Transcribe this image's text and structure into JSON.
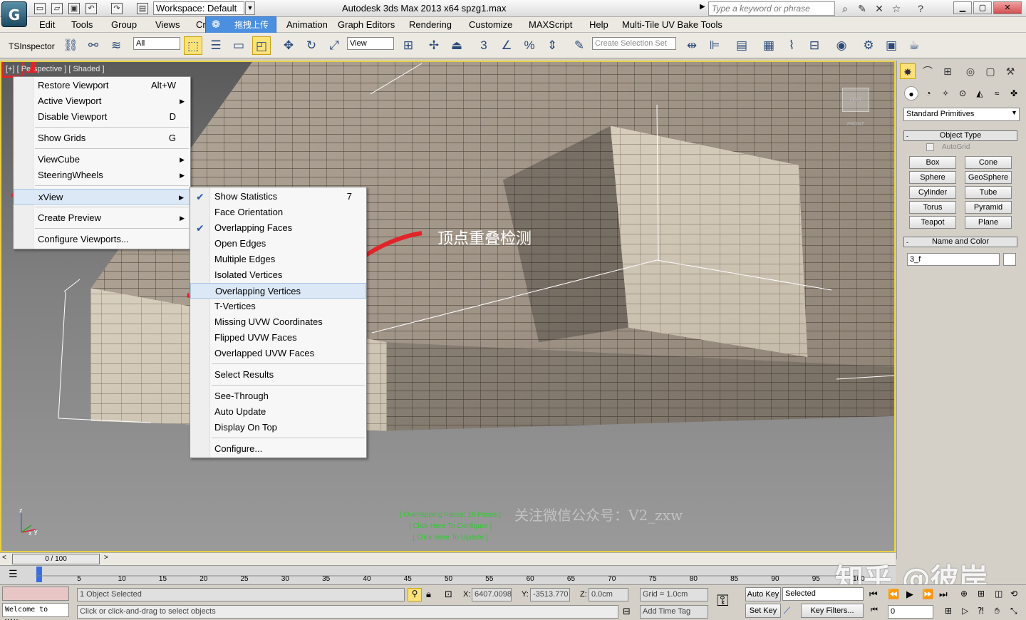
{
  "titlebar": {
    "workspace": "Workspace: Default",
    "title": "Autodesk 3ds Max  2013 x64      spzg1.max",
    "search_placeholder": "Type a keyword or phrase",
    "app_logo": "3ds-max-logo"
  },
  "menubar": {
    "items": [
      "Edit",
      "Tools",
      "Group",
      "Views",
      "Cr",
      "Animation",
      "Graph Editors",
      "Rendering",
      "Customize",
      "MAXScript",
      "Help",
      "Multi-Tile UV Bake Tools"
    ],
    "upload_tag": "拖拽上传"
  },
  "toolbar": {
    "tsinspector": "TSInspector",
    "selection_filter": "All",
    "ref_coord": "View",
    "named_selection": "Create Selection Set",
    "icons": [
      "link-icon",
      "unlink-icon",
      "bind-space-warp-icon",
      "select-icon",
      "select-by-name-icon",
      "rect-region-icon",
      "window-crossing-icon",
      "move-icon",
      "rotate-icon",
      "scale-icon",
      "pivot-icon",
      "select-manipulate-icon",
      "keyboard-shortcut-icon",
      "snap-3d-icon",
      "angle-snap-icon",
      "percent-snap-icon",
      "spinner-snap-icon",
      "edit-named-sel-icon",
      "mirror-icon",
      "align-icon",
      "layer-manager-icon",
      "graphite-icon",
      "curve-editor-icon",
      "schematic-icon",
      "material-editor-icon",
      "render-setup-icon",
      "render-frame-icon",
      "render-icon",
      "teapot-icon"
    ]
  },
  "viewport": {
    "label_plus": "[+]",
    "label_rest": "[ Perspective ] [ Shaded ]",
    "viewcube_text": "LEFT  FRONT",
    "stats_lines": [
      "[ Overlapping Faces: 18 Faces ]",
      "[ Click Here To Configure ]",
      "[ Click Here To Update ]"
    ],
    "watermark": "关注微信公众号：V2_zxw",
    "annotation": "顶点重叠检测",
    "marks": [
      "1",
      "2",
      "3"
    ],
    "axis": {
      "z": "z",
      "x": "x",
      "y": "y"
    }
  },
  "menu1": {
    "items": [
      {
        "label": "Restore Viewport",
        "shortcut": "Alt+W",
        "sub": false
      },
      {
        "label": "Active Viewport",
        "shortcut": "",
        "sub": true
      },
      {
        "label": "Disable Viewport",
        "shortcut": "D",
        "sub": false
      },
      {
        "label": "Show Grids",
        "shortcut": "G",
        "sub": false
      },
      {
        "label": "ViewCube",
        "shortcut": "",
        "sub": true
      },
      {
        "label": "SteeringWheels",
        "shortcut": "",
        "sub": true
      },
      {
        "label": "xView",
        "shortcut": "",
        "sub": true
      },
      {
        "label": "Create Preview",
        "shortcut": "",
        "sub": true
      },
      {
        "label": "Configure Viewports...",
        "shortcut": "",
        "sub": false
      }
    ]
  },
  "menu2": {
    "items": [
      {
        "label": "Show Statistics",
        "shortcut": "7",
        "checked": true
      },
      {
        "label": "Face Orientation",
        "shortcut": "",
        "checked": false
      },
      {
        "label": "Overlapping Faces",
        "shortcut": "",
        "checked": true
      },
      {
        "label": "Open Edges",
        "shortcut": "",
        "checked": false
      },
      {
        "label": "Multiple Edges",
        "shortcut": "",
        "checked": false
      },
      {
        "label": "Isolated Vertices",
        "shortcut": "",
        "checked": false
      },
      {
        "label": "Overlapping Vertices",
        "shortcut": "",
        "checked": false
      },
      {
        "label": "T-Vertices",
        "shortcut": "",
        "checked": false
      },
      {
        "label": "Missing UVW Coordinates",
        "shortcut": "",
        "checked": false
      },
      {
        "label": "Flipped UVW Faces",
        "shortcut": "",
        "checked": false
      },
      {
        "label": "Overlapped UVW Faces",
        "shortcut": "",
        "checked": false
      },
      {
        "label": "Select Results",
        "shortcut": "",
        "checked": false
      },
      {
        "label": "See-Through",
        "shortcut": "",
        "checked": false
      },
      {
        "label": "Auto Update",
        "shortcut": "",
        "checked": false
      },
      {
        "label": "Display On Top",
        "shortcut": "",
        "checked": false
      },
      {
        "label": "Configure...",
        "shortcut": "",
        "checked": false
      }
    ]
  },
  "command_panel": {
    "tabs": [
      "create-tab-icon",
      "modify-tab-icon",
      "hierarchy-tab-icon",
      "motion-tab-icon",
      "display-tab-icon",
      "utilities-tab-icon"
    ],
    "subtabs": [
      "geometry-icon",
      "shapes-icon",
      "lights-icon",
      "cameras-icon",
      "helpers-icon",
      "space-warps-icon",
      "systems-icon"
    ],
    "primitive_type": "Standard Primitives",
    "object_type_title": "Object Type",
    "autogrid": "AutoGrid",
    "buttons": [
      "Box",
      "Cone",
      "Sphere",
      "GeoSphere",
      "Cylinder",
      "Tube",
      "Torus",
      "Pyramid",
      "Teapot",
      "Plane"
    ],
    "name_color_title": "Name and Color",
    "object_name": "3_f"
  },
  "timeline": {
    "frame": "0 / 100",
    "ticks": [
      "5",
      "10",
      "15",
      "20",
      "25",
      "30",
      "35",
      "40",
      "45",
      "50",
      "55",
      "60",
      "65",
      "70",
      "75",
      "80",
      "85",
      "90",
      "95",
      "100"
    ],
    "watermark": "知乎 @彼岸"
  },
  "statusbar": {
    "maxscript": "Welcome to MAX:",
    "selection": "1 Object Selected",
    "prompt": "Click or click-and-drag to select objects",
    "x_label": "X:",
    "x_value": "6407.0098",
    "y_label": "Y:",
    "y_value": "-3513.770",
    "z_label": "Z:",
    "z_value": "0.0cm",
    "grid": "Grid = 1.0cm",
    "add_time_tag": "Add Time Tag",
    "auto_key": "Auto Key",
    "set_key": "Set Key",
    "key_mode": "Selected",
    "key_filters": "Key Filters...",
    "current_frame": "0"
  },
  "colors": {
    "viewport_border": "#e7cf45",
    "annotation_red": "#e2242a",
    "stats_green": "#32c832"
  }
}
